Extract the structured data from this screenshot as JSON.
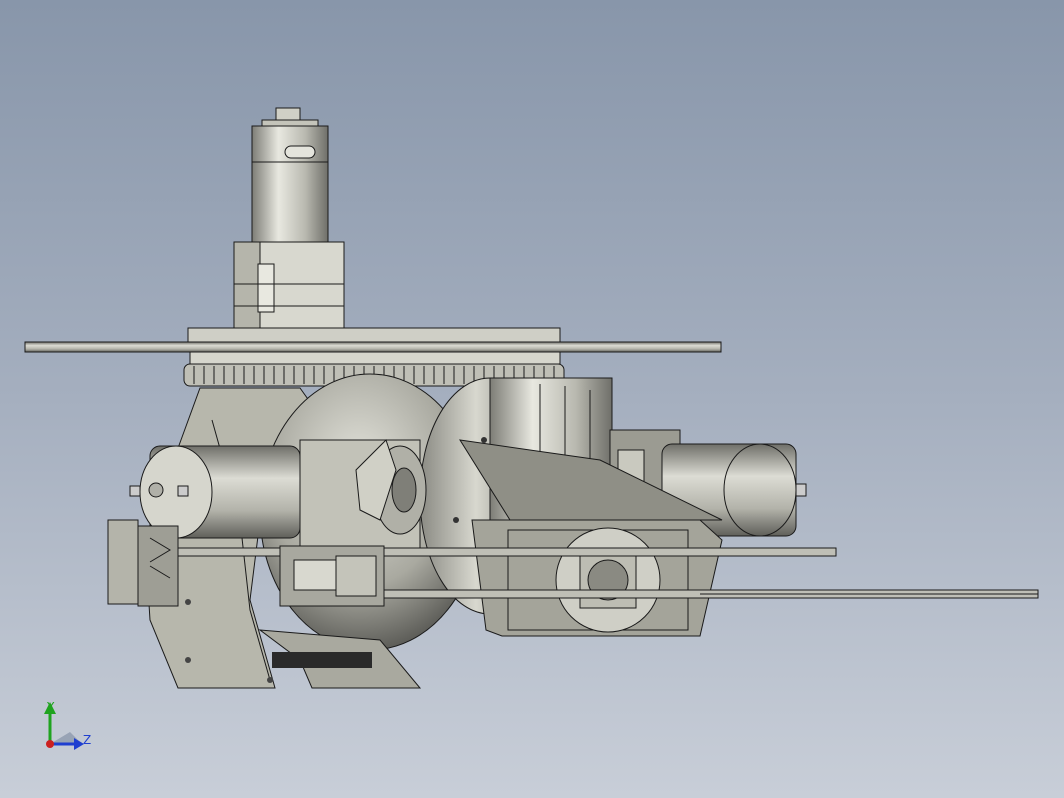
{
  "viewport": {
    "background_top": "#8896aa",
    "background_bottom": "#c8ced8"
  },
  "model": {
    "part_fill": "#c9c9bf",
    "part_shade": "#8c8c84",
    "outline": "#1a1a1a"
  },
  "triad": {
    "y_label": "Y",
    "z_label": "Z",
    "y_color": "#1fa31f",
    "z_color": "#1f3fd0",
    "x_color": "#cc2020"
  }
}
